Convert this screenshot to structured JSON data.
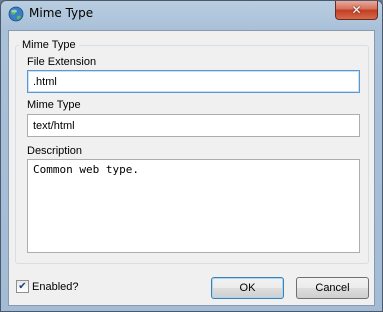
{
  "window": {
    "title": "Mime Type",
    "close_glyph": "✕",
    "icon": "globe-app-icon"
  },
  "group": {
    "legend": "Mime Type"
  },
  "fields": {
    "file_extension": {
      "label": "File Extension",
      "value": ".html"
    },
    "mime_type": {
      "label": "Mime Type",
      "value": "text/html"
    },
    "description": {
      "label": "Description",
      "value": "Common web type."
    }
  },
  "enabled": {
    "label": "Enabled?",
    "checked": true,
    "check_glyph": "✔"
  },
  "buttons": {
    "ok": "OK",
    "cancel": "Cancel"
  },
  "colors": {
    "accent": "#3c7fb1",
    "close": "#c23d22",
    "chrome": "#a8c0d8"
  }
}
